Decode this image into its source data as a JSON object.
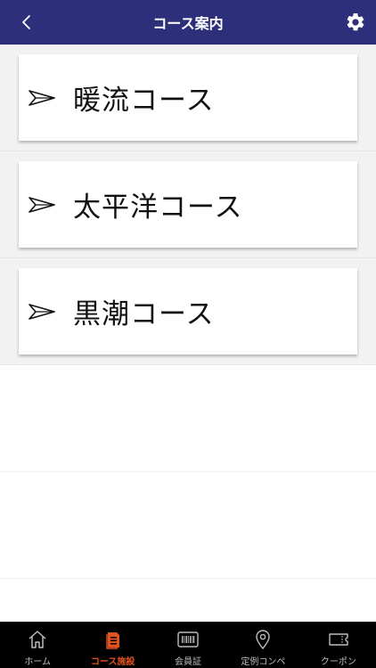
{
  "header": {
    "title": "コース案内",
    "back_icon": "chevron-left-icon",
    "settings_icon": "gear-icon",
    "background": "#2d2f7a"
  },
  "courses": [
    {
      "label": "暖流コース",
      "icon": "arrow-right-icon"
    },
    {
      "label": "太平洋コース",
      "icon": "arrow-right-icon"
    },
    {
      "label": "黒潮コース",
      "icon": "arrow-right-icon"
    }
  ],
  "tabbar": {
    "active_color": "#e2521f",
    "inactive_color": "#bdbdbd",
    "items": [
      {
        "label": "ホーム",
        "icon": "home-icon",
        "active": false
      },
      {
        "label": "コース施設",
        "icon": "document-icon",
        "active": true
      },
      {
        "label": "会員証",
        "icon": "barcode-icon",
        "active": false
      },
      {
        "label": "定例コンペ",
        "icon": "location-pin-icon",
        "active": false
      },
      {
        "label": "クーポン",
        "icon": "ticket-icon",
        "active": false
      }
    ]
  }
}
